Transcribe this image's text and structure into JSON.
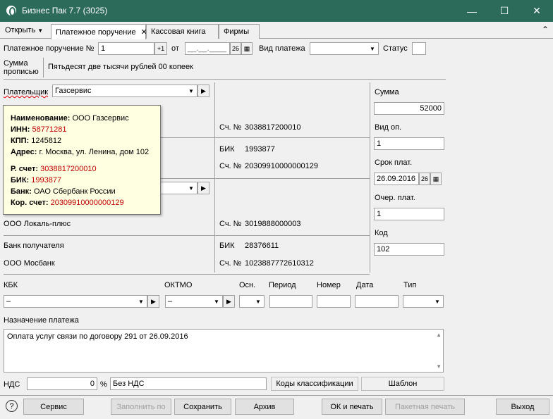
{
  "window": {
    "title": "Бизнес Пак 7.7 (3025)",
    "minimize": "—",
    "maximize": "☐",
    "close": "✕"
  },
  "tabs": {
    "open_menu": "Открыть",
    "items": [
      "Платежное поручение",
      "Кассовая книга",
      "Фирмы"
    ],
    "close_icon": "✕",
    "collapse_icon": "⌃"
  },
  "header": {
    "order_label": "Платежное поручение №",
    "order_number": "1",
    "increment": "+1",
    "from_label": "от",
    "date_value": "__.__.____",
    "date_btn": "26",
    "payment_type_label": "Вид платежа",
    "payment_type_value": "",
    "status_label": "Статус",
    "status_value": ""
  },
  "sum_words": {
    "label_line1": "Сумма",
    "label_line2": "прописью",
    "value": "Пятьдесят две тысячи рублей 00 копеек"
  },
  "payer": {
    "label": "Плательщик",
    "value": "Газсервис",
    "account_label": "Сч. №",
    "account": "3038817200010",
    "bik_label": "БИК",
    "bik": "1993877",
    "corr_label": "Сч. №",
    "corr": "20309910000000129"
  },
  "tooltip": {
    "name_label": "Наименование:",
    "name": "ООО Газсервис",
    "inn_label": "ИНН:",
    "inn": "58771281",
    "kpp_label": "КПП:",
    "kpp": "1245812",
    "addr_label": "Адрес:",
    "addr": "г. Москва, ул. Ленина, дом 102",
    "rs_label": "Р. счет:",
    "rs": "3038817200010",
    "bik_label": "БИК:",
    "bik": "1993877",
    "bank_label": "Банк:",
    "bank": "ОАО Сбербанк России",
    "ks_label": "Кор. счет:",
    "ks": "20309910000000129"
  },
  "recipient": {
    "name": "ООО Локаль-плюс",
    "account_label": "Сч. №",
    "account": "3019888000003",
    "bank_label": "Банк получателя",
    "bank": "ООО Мосбанк",
    "bik_label": "БИК",
    "bik": "28376611",
    "corr_label": "Сч. №",
    "corr": "1023887772610312"
  },
  "right_panel": {
    "sum_label": "Сумма",
    "sum": "52000",
    "op_label": "Вид оп.",
    "op": "1",
    "term_label": "Срок плат.",
    "term": "26.09.2016",
    "term_btn": "26",
    "queue_label": "Очер. плат.",
    "queue": "1",
    "code_label": "Код",
    "code": "102"
  },
  "budget": {
    "kbk_label": "КБК",
    "kbk": "–",
    "oktmo_label": "ОКТМО",
    "oktmo": "–",
    "osn_label": "Осн.",
    "period_label": "Период",
    "number_label": "Номер",
    "date_label": "Дата",
    "type_label": "Тип"
  },
  "purpose": {
    "label": "Назначение платежа",
    "value": "Оплата услуг связи по договору 291 от 26.09.2016"
  },
  "vat": {
    "label": "НДС",
    "value": "0",
    "percent": "%",
    "text": "Без НДС",
    "codes_btn": "Коды классификации",
    "template_btn": "Шаблон"
  },
  "footer": {
    "help": "?",
    "service": "Сервис",
    "fill": "Заполнить по",
    "save": "Сохранить",
    "archive": "Архив",
    "ok_print": "ОК и печать",
    "batch_print": "Пакетная печать",
    "exit": "Выход"
  }
}
